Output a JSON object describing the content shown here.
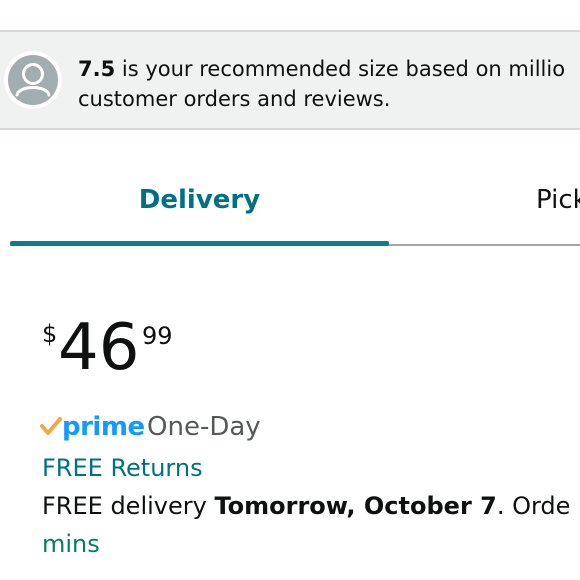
{
  "size_banner": {
    "size": "7.5",
    "text_line1": " is your recommended size based on millio",
    "text_line2": "customer orders and reviews."
  },
  "tabs": [
    {
      "label": "Delivery",
      "selected": true
    },
    {
      "label": "Pick",
      "selected": false
    }
  ],
  "price": {
    "symbol": "$",
    "whole": "46",
    "fraction": "99"
  },
  "prime": {
    "word": "prime",
    "speed": "One-Day"
  },
  "returns": {
    "label": "FREE Returns"
  },
  "delivery": {
    "prefix": "FREE delivery ",
    "date": "Tomorrow, October 7",
    "suffix": ". Orde",
    "countdown_tail": "mins"
  },
  "colors": {
    "accent_teal": "#007185",
    "prime_blue": "#1399ff",
    "prime_check": "#f3a847",
    "countdown_green": "#067d62"
  },
  "icons": {
    "avatar": "user-avatar-icon",
    "prime_check": "prime-check-icon"
  }
}
